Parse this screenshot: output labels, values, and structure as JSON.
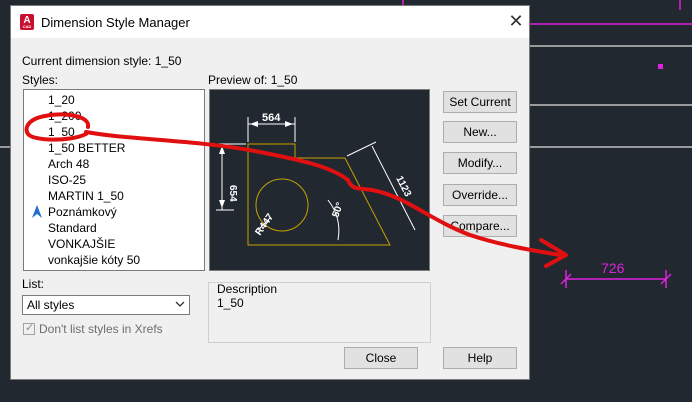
{
  "window": {
    "title": "Dimension Style Manager",
    "app_icon_letter": "A",
    "app_icon_sub": "CAD"
  },
  "current_style": {
    "label": "Current dimension style: 1_50"
  },
  "styles": {
    "label": "Styles:",
    "items": [
      {
        "label": "1_20"
      },
      {
        "label": "1_200"
      },
      {
        "label": "1_50"
      },
      {
        "label": "1_50 BETTER"
      },
      {
        "label": "Arch 48"
      },
      {
        "label": "ISO-25"
      },
      {
        "label": "MARTIN 1_50"
      },
      {
        "label": "Poznámkový",
        "icon": "annotative-icon"
      },
      {
        "label": "Standard"
      },
      {
        "label": "VONKAJŠIE"
      },
      {
        "label": "vonkajšie kóty 50"
      }
    ]
  },
  "list_filter": {
    "label": "List:",
    "selected": "All styles"
  },
  "xref_checkbox": {
    "label": "Don't list styles in Xrefs",
    "checked": true,
    "enabled": false
  },
  "preview": {
    "label": "Preview of: 1_50",
    "dims": {
      "top": "564",
      "left": "654",
      "diag": "1123",
      "radius": "R447",
      "angle": "50°"
    }
  },
  "description": {
    "label": "Description",
    "value": "1_50"
  },
  "buttons": {
    "set_current": "Set Current",
    "new": "New...",
    "modify": "Modify...",
    "override": "Override...",
    "compare": "Compare...",
    "close": "Close",
    "help": "Help"
  },
  "cad_dimension": {
    "value": "726"
  },
  "colors": {
    "annotation": "#e01010",
    "cad_dim": "#e020e0",
    "cad_bg": "#212830",
    "preview_geom": "#c8a000"
  }
}
